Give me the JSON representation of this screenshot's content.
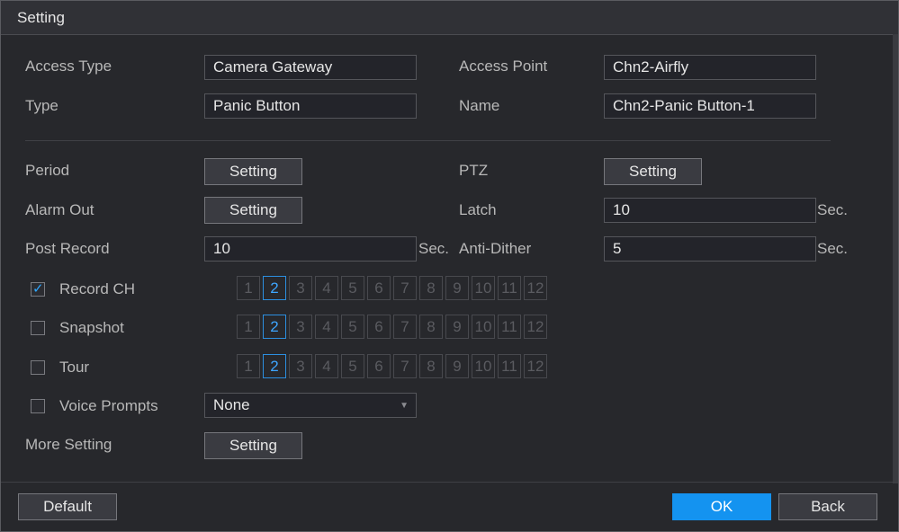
{
  "window": {
    "title": "Setting"
  },
  "form": {
    "access_type": {
      "label": "Access Type",
      "value": "Camera Gateway"
    },
    "access_point": {
      "label": "Access Point",
      "value": "Chn2-Airfly"
    },
    "type": {
      "label": "Type",
      "value": "Panic Button"
    },
    "name": {
      "label": "Name",
      "value": "Chn2-Panic Button-1"
    },
    "period": {
      "label": "Period",
      "button": "Setting"
    },
    "ptz": {
      "label": "PTZ",
      "button": "Setting"
    },
    "alarm_out": {
      "label": "Alarm Out",
      "button": "Setting"
    },
    "latch": {
      "label": "Latch",
      "value": "10",
      "unit": "Sec."
    },
    "post_record": {
      "label": "Post Record",
      "value": "10",
      "unit": "Sec."
    },
    "anti_dither": {
      "label": "Anti-Dither",
      "value": "5",
      "unit": "Sec."
    },
    "record_ch": {
      "label": "Record CH",
      "checked": true
    },
    "snapshot": {
      "label": "Snapshot",
      "checked": false
    },
    "tour": {
      "label": "Tour",
      "checked": false
    },
    "voice_prompts": {
      "label": "Voice Prompts",
      "checked": false,
      "value": "None"
    },
    "more_setting": {
      "label": "More Setting",
      "button": "Setting"
    },
    "channels": [
      "1",
      "2",
      "3",
      "4",
      "5",
      "6",
      "7",
      "8",
      "9",
      "10",
      "11",
      "12"
    ],
    "selected_channel": "2"
  },
  "footer": {
    "default": "Default",
    "ok": "OK",
    "back": "Back"
  },
  "colors": {
    "accent": "#1493f0",
    "selected_channel": "#3ea6ff"
  }
}
